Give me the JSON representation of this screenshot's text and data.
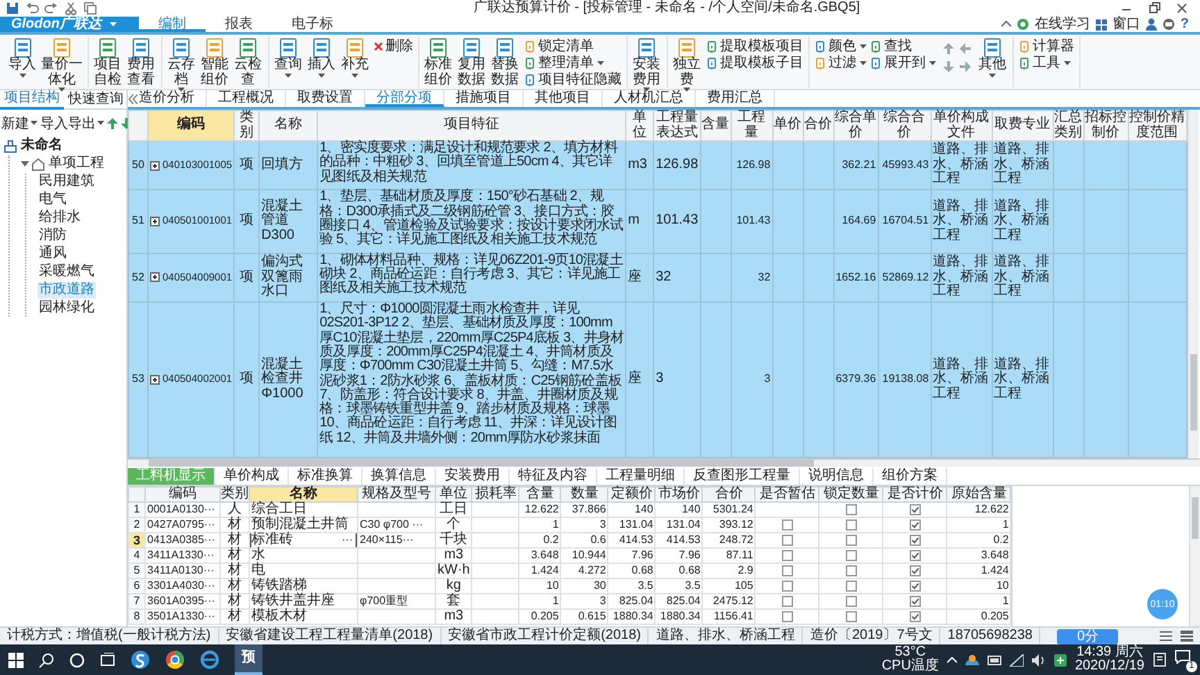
{
  "window": {
    "title": "广联达预算计价 - [投标管理 - 未命名 - /个人空间/未命名.GBQ5]"
  },
  "logo": "Glodon广联达",
  "ribbon_tabs": [
    {
      "label": "编制",
      "selected": true
    },
    {
      "label": "报表",
      "selected": false
    },
    {
      "label": "电子标",
      "selected": false
    }
  ],
  "help_bar": {
    "learning": "在线学习",
    "window_menu": "窗口",
    "help": "?"
  },
  "ribbon_groups": [
    [
      {
        "kind": "large",
        "label": "导入",
        "menu": true
      },
      {
        "kind": "large",
        "label": "量价一体化",
        "menu": true
      }
    ],
    [
      {
        "kind": "large",
        "label": "项目自检",
        "menu": false
      },
      {
        "kind": "large",
        "label": "费用查看",
        "menu": false
      }
    ],
    [
      {
        "kind": "large",
        "label": "云存档",
        "menu": true
      },
      {
        "kind": "large",
        "label": "智能组价",
        "menu": false
      },
      {
        "kind": "large",
        "label": "云检查",
        "menu": false
      }
    ],
    [
      {
        "kind": "large",
        "label": "查询",
        "menu": true
      },
      {
        "kind": "large",
        "label": "插入",
        "menu": true
      },
      {
        "kind": "large",
        "label": "补充",
        "menu": true
      },
      {
        "kind": "delete",
        "label": "删除",
        "menu": false
      }
    ],
    [
      {
        "kind": "large",
        "label": "标准组价",
        "menu": false
      },
      {
        "kind": "large",
        "label": "复用数据",
        "menu": false
      },
      {
        "kind": "large",
        "label": "替换数据",
        "menu": false
      },
      {
        "kind": "stack",
        "items": [
          {
            "label": "锁定清单",
            "menu": false
          },
          {
            "label": "整理清单",
            "menu": true
          },
          {
            "label": "项目特征隐藏",
            "menu": false
          }
        ]
      }
    ],
    [
      {
        "kind": "large",
        "label": "安装费用",
        "menu": true
      }
    ],
    [
      {
        "kind": "large",
        "label": "独立费",
        "menu": true
      },
      {
        "kind": "stack",
        "items": [
          {
            "label": "提取模板项目",
            "menu": false
          },
          {
            "label": "提取模板子目",
            "menu": false
          }
        ]
      }
    ],
    [
      {
        "kind": "stack",
        "items": [
          {
            "label": "颜色",
            "menu": true
          },
          {
            "label": "过滤",
            "menu": true
          }
        ]
      },
      {
        "kind": "stack",
        "items": [
          {
            "label": "查找",
            "menu": false
          },
          {
            "label": "展开到",
            "menu": true
          }
        ]
      },
      {
        "kind": "arrows"
      },
      {
        "kind": "large",
        "label": "其他",
        "menu": true
      }
    ],
    [
      {
        "kind": "stack",
        "items": [
          {
            "label": "计算器",
            "menu": false
          },
          {
            "label": "工具",
            "menu": true
          }
        ]
      }
    ]
  ],
  "left_tabs": [
    {
      "label": "项目结构",
      "selected": true
    },
    {
      "label": "快速查询",
      "selected": false
    }
  ],
  "left_toolbar": [
    {
      "label": "新建",
      "menu": true
    },
    {
      "label": "导入导出",
      "menu": true
    }
  ],
  "tree": [
    {
      "label": "未命名",
      "selected": false,
      "children": [
        {
          "label": "单项工程",
          "selected": false,
          "expanded": true,
          "children": [
            {
              "label": "民用建筑",
              "selected": false
            },
            {
              "label": "电气",
              "selected": false
            },
            {
              "label": "给排水",
              "selected": false
            },
            {
              "label": "消防",
              "selected": false
            },
            {
              "label": "通风",
              "selected": false
            },
            {
              "label": "采暖燃气",
              "selected": false
            },
            {
              "label": "市政道路",
              "selected": true
            },
            {
              "label": "园林绿化",
              "selected": false
            }
          ]
        }
      ]
    }
  ],
  "page_tabs": [
    {
      "label": "造价分析",
      "selected": false
    },
    {
      "label": "工程概况",
      "selected": false
    },
    {
      "label": "取费设置",
      "selected": false
    },
    {
      "label": "分部分项",
      "selected": true
    },
    {
      "label": "措施项目",
      "selected": false
    },
    {
      "label": "其他项目",
      "selected": false
    },
    {
      "label": "人材机汇总",
      "selected": false
    },
    {
      "label": "费用汇总",
      "selected": false
    }
  ],
  "table": {
    "columns": [
      {
        "label": "编码",
        "kind": "code",
        "selected": true
      },
      {
        "label": "类别",
        "kind": "center",
        "selected": false
      },
      {
        "label": "名称",
        "kind": "text",
        "selected": false
      },
      {
        "label": "项目特征",
        "kind": "feature",
        "selected": false
      },
      {
        "label": "单位",
        "kind": "text",
        "selected": false
      },
      {
        "label": "工程量表达式",
        "kind": "text",
        "selected": false
      },
      {
        "label": "含量",
        "kind": "number",
        "selected": false
      },
      {
        "label": "工程量",
        "kind": "number",
        "selected": false
      },
      {
        "label": "单价",
        "kind": "number",
        "selected": false
      },
      {
        "label": "合价",
        "kind": "number",
        "selected": false
      },
      {
        "label": "综合单价",
        "kind": "number",
        "selected": false
      },
      {
        "label": "综合合价",
        "kind": "number",
        "selected": false
      },
      {
        "label": "单价构成文件",
        "kind": "text",
        "selected": false
      },
      {
        "label": "取费专业",
        "kind": "text",
        "selected": false
      },
      {
        "label": "汇总类别",
        "kind": "text",
        "selected": false
      },
      {
        "label": "招标控制价",
        "kind": "number",
        "selected": false
      },
      {
        "label": "控制价精度范围",
        "kind": "text",
        "selected": false
      }
    ],
    "rows": [
      {
        "number": "50",
        "selected": true,
        "expandable": true,
        "cells": [
          "040103001005",
          "项",
          "回填方",
          "1、密实度要求：满足设计和规范要求 2、填方材料的品种：中粗砂 3、回填至管道上50cm 4、其它详见图纸及相关规范",
          "m3",
          "126.98",
          null,
          "126.98",
          null,
          null,
          "362.21",
          "45993.43",
          "道路、排水、桥涵工程",
          "道路、排水、桥涵工程",
          null,
          null,
          null
        ]
      },
      {
        "number": "51",
        "selected": true,
        "expandable": true,
        "cells": [
          "040501001001",
          "项",
          "混凝土管道D300",
          "1、垫层、基础材质及厚度：150°砂石基础 2、规格：D300承插式及二级钢筋砼管 3、接口方式：胶圈接口 4、管道检验及试验要求：按设计要求闭水试验 5、其它：详见施工图纸及相关施工技术规范",
          "m",
          "101.43",
          null,
          "101.43",
          null,
          null,
          "164.69",
          "16704.51",
          "道路、排水、桥涵工程",
          "道路、排水、桥涵工程",
          null,
          null,
          null
        ]
      },
      {
        "number": "52",
        "selected": true,
        "expandable": true,
        "cells": [
          "040504009001",
          "项",
          "偏沟式双篦雨水口",
          "1、砌体材料品种、规格：详见06Z201-9页10混凝土砌块 2、商品砼运距：自行考虑 3、其它：详见施工图纸及相关施工技术规范",
          "座",
          "32",
          null,
          "32",
          null,
          null,
          "1652.16",
          "52869.12",
          "道路、排水、桥涵工程",
          "道路、排水、桥涵工程",
          null,
          null,
          null
        ]
      },
      {
        "number": "53",
        "selected": true,
        "expandable": true,
        "cells": [
          "040504002001",
          "项",
          "混凝土检查井Φ1000",
          "1、尺寸：Φ1000圆混凝土雨水检查井，详见02S201-3P12 2、垫层、基础材质及厚度：100mm厚C10混凝土垫层，220mm厚C25P4底板 3、井身材质及厚度：200mm厚C25P4混凝土 4、井筒材质及厚度：Φ700mm C30混凝土井筒 5、勾缝：M7.5水泥砂浆1：2防水砂浆 6、盖板材质：C25钢筋砼盖板 7、防盖形：符合设计要求 8、井盖、井圈材质及规格：球墨铸铁重型井盖 9、踏步材质及规格：球墨 10、商品砼运距：自行考虑 11、井深：详见设计图纸 12、井筒及井墙外侧：20mm厚防水砂浆抹面",
          "座",
          "3",
          null,
          "3",
          null,
          null,
          "6379.36",
          "19138.08",
          "道路、排水、桥涵工程",
          "道路、排水、桥涵工程",
          null,
          null,
          null
        ]
      }
    ]
  },
  "bottom_tabs": [
    {
      "label": "工料机显示",
      "selected": true
    },
    {
      "label": "单价构成",
      "selected": false
    },
    {
      "label": "标准换算",
      "selected": false
    },
    {
      "label": "换算信息",
      "selected": false
    },
    {
      "label": "安装费用",
      "selected": false
    },
    {
      "label": "特征及内容",
      "selected": false
    },
    {
      "label": "工程量明细",
      "selected": false
    },
    {
      "label": "反查图形工程量",
      "selected": false
    },
    {
      "label": "说明信息",
      "selected": false
    },
    {
      "label": "组价方案",
      "selected": false
    }
  ],
  "resources": {
    "columns": [
      {
        "label": "编码",
        "kind": "text",
        "selected": false
      },
      {
        "label": "类别",
        "kind": "center",
        "selected": false
      },
      {
        "label": "名称",
        "kind": "name",
        "selected": true
      },
      {
        "label": "规格及型号",
        "kind": "text",
        "selected": false
      },
      {
        "label": "单位",
        "kind": "center",
        "selected": false
      },
      {
        "label": "损耗率",
        "kind": "number",
        "selected": false
      },
      {
        "label": "含量",
        "kind": "number",
        "selected": false
      },
      {
        "label": "数量",
        "kind": "number",
        "selected": false
      },
      {
        "label": "定额价",
        "kind": "number",
        "selected": false
      },
      {
        "label": "市场价",
        "kind": "number",
        "selected": false
      },
      {
        "label": "合价",
        "kind": "number",
        "selected": false
      },
      {
        "label": "是否暂估",
        "kind": "check",
        "selected": false
      },
      {
        "label": "锁定数量",
        "kind": "check",
        "selected": false
      },
      {
        "label": "是否计价",
        "kind": "check",
        "selected": false
      },
      {
        "label": "原始含量",
        "kind": "number",
        "selected": false
      }
    ],
    "rows": [
      {
        "number": "1",
        "current": false,
        "cells": [
          "0001A0130···",
          "人",
          "综合工日",
          null,
          "工日",
          null,
          "12.622",
          "37.866",
          "140",
          "140",
          "5301.24",
          "12.622"
        ],
        "checks": {
          "locked": false,
          "priced": true
        }
      },
      {
        "number": "2",
        "current": false,
        "cells": [
          "0427A0795···",
          "材",
          "预制混凝土井筒",
          "C30 φ700 ···",
          "个",
          null,
          "1",
          "3",
          "131.04",
          "131.04",
          "393.12",
          "1"
        ],
        "checks": {
          "estimate": false,
          "locked": false,
          "priced": true
        }
      },
      {
        "number": "3",
        "current": true,
        "name_button": "···",
        "cells": [
          "0413A0385···",
          "材",
          "标准砖",
          "240×115···",
          "千块",
          null,
          "0.2",
          "0.6",
          "414.53",
          "414.53",
          "248.72",
          "0.2"
        ],
        "checks": {
          "estimate": false,
          "locked": false,
          "priced": true
        }
      },
      {
        "number": "4",
        "current": false,
        "cells": [
          "3411A1330···",
          "材",
          "水",
          null,
          "m3",
          null,
          "3.648",
          "10.944",
          "7.96",
          "7.96",
          "87.11",
          "3.648"
        ],
        "checks": {
          "estimate": false,
          "locked": false,
          "priced": true
        }
      },
      {
        "number": "5",
        "current": false,
        "cells": [
          "3411A0130···",
          "材",
          "电",
          null,
          "kW·h",
          null,
          "1.424",
          "4.272",
          "0.68",
          "0.68",
          "2.9",
          "1.424"
        ],
        "checks": {
          "estimate": false,
          "locked": false,
          "priced": true
        }
      },
      {
        "number": "6",
        "current": false,
        "cells": [
          "3301A4030···",
          "材",
          "铸铁踏梯",
          null,
          "kg",
          null,
          "10",
          "30",
          "3.5",
          "3.5",
          "105",
          "10"
        ],
        "checks": {
          "estimate": false,
          "locked": false,
          "priced": true
        }
      },
      {
        "number": "7",
        "current": false,
        "cells": [
          "3601A0395···",
          "材",
          "铸铁井盖井座",
          "φ700重型",
          "套",
          null,
          "1",
          "3",
          "825.04",
          "825.04",
          "2475.12",
          "1"
        ],
        "checks": {
          "estimate": false,
          "locked": false,
          "priced": true
        }
      },
      {
        "number": "8",
        "current": false,
        "cells": [
          "3501A1330···",
          "材",
          "模板木材",
          null,
          "m3",
          null,
          "0.205",
          "0.615",
          "1880.34",
          "1880.34",
          "1156.41",
          "0.205"
        ],
        "checks": {
          "estimate": false,
          "locked": false,
          "priced": true
        }
      }
    ]
  },
  "status_bar": {
    "items": [
      "计税方式：增值税(一般计税方法)",
      "安徽省建设工程工程量清单(2018)",
      "安徽省市政工程计价定额(2018)",
      "道路、排水、桥涵工程",
      "造价〔2019〕7号文",
      "18705698238"
    ],
    "score_button": "0分"
  },
  "timer": "01:10",
  "taskbar": {
    "app_label": "预",
    "temperature": "53°C",
    "temperature_label": "CPU温度",
    "time": "14:39 周六",
    "date": "2020/12/19",
    "notifications": "1"
  }
}
